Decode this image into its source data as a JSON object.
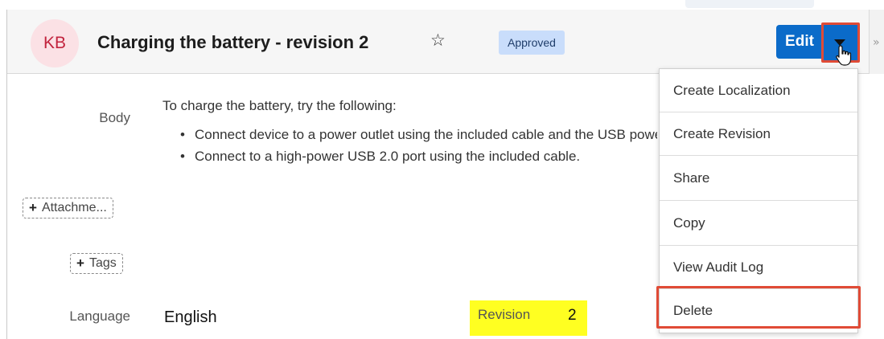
{
  "header": {
    "avatar_initials": "KB",
    "title": "Charging the battery - revision 2",
    "favorite_icon": "star-outline-icon",
    "status_badge": "Approved",
    "edit_label": "Edit",
    "actions_caret_icon": "caret-down-icon",
    "collapse_icon": "double-chevron-right-icon",
    "collapse_glyph": "»"
  },
  "record": {
    "body_label": "Body",
    "body_intro": "To charge the battery, try the following:",
    "body_bullets": [
      "Connect device to a power outlet using the included cable and the USB power adapter.",
      "Connect to a high-power USB 2.0 port using the included cable."
    ],
    "attachments_label": "Attachme...",
    "tags_label": "Tags",
    "language_label": "Language",
    "language_value": "English",
    "revision_label": "Revision",
    "revision_value": "2"
  },
  "actions_menu": {
    "items": [
      {
        "label": "Create Localization"
      },
      {
        "label": "Create Revision"
      },
      {
        "label": "Share"
      },
      {
        "label": "Copy"
      },
      {
        "label": "View Audit Log"
      },
      {
        "label": "Delete"
      }
    ]
  },
  "colors": {
    "primary_button": "#0b6bc9",
    "highlight_outline": "#e04b36",
    "revision_highlight": "#ffff21",
    "badge_background": "#c9ddfb",
    "avatar_background": "#fbe1e5",
    "avatar_text": "#c2243e"
  }
}
